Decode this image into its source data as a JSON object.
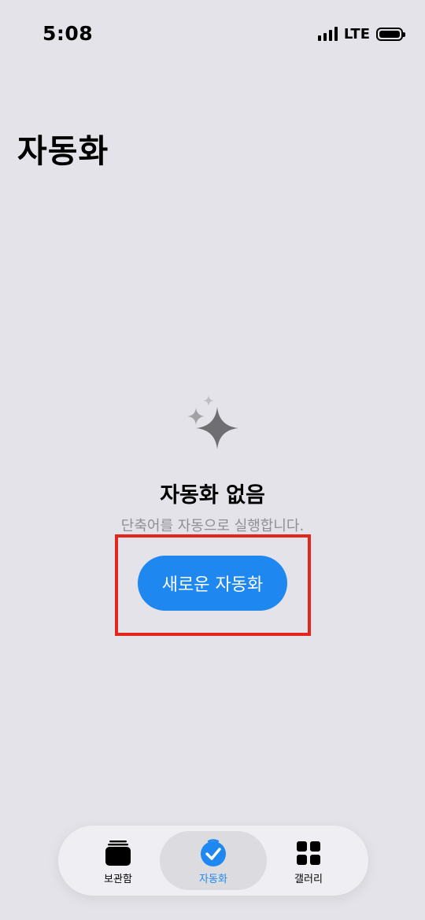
{
  "status_bar": {
    "time": "5:08",
    "network": "LTE"
  },
  "page": {
    "title": "자동화"
  },
  "empty_state": {
    "icon": "sparkles-icon",
    "title": "자동화 없음",
    "subtitle": "단축어를 자동으로 실행합니다."
  },
  "new_button": {
    "label": "새로운 자동화"
  },
  "tab_bar": {
    "tabs": [
      {
        "label": "보관함",
        "icon": "library-stack-icon",
        "active": false
      },
      {
        "label": "자동화",
        "icon": "checkmark-circle-icon",
        "active": true
      },
      {
        "label": "갤러리",
        "icon": "grid-icon",
        "active": false
      }
    ]
  },
  "colors": {
    "background": "#e4e3e9",
    "accent": "#1e88f0",
    "highlight": "#e3261b",
    "secondary_text": "#8e8e93"
  }
}
